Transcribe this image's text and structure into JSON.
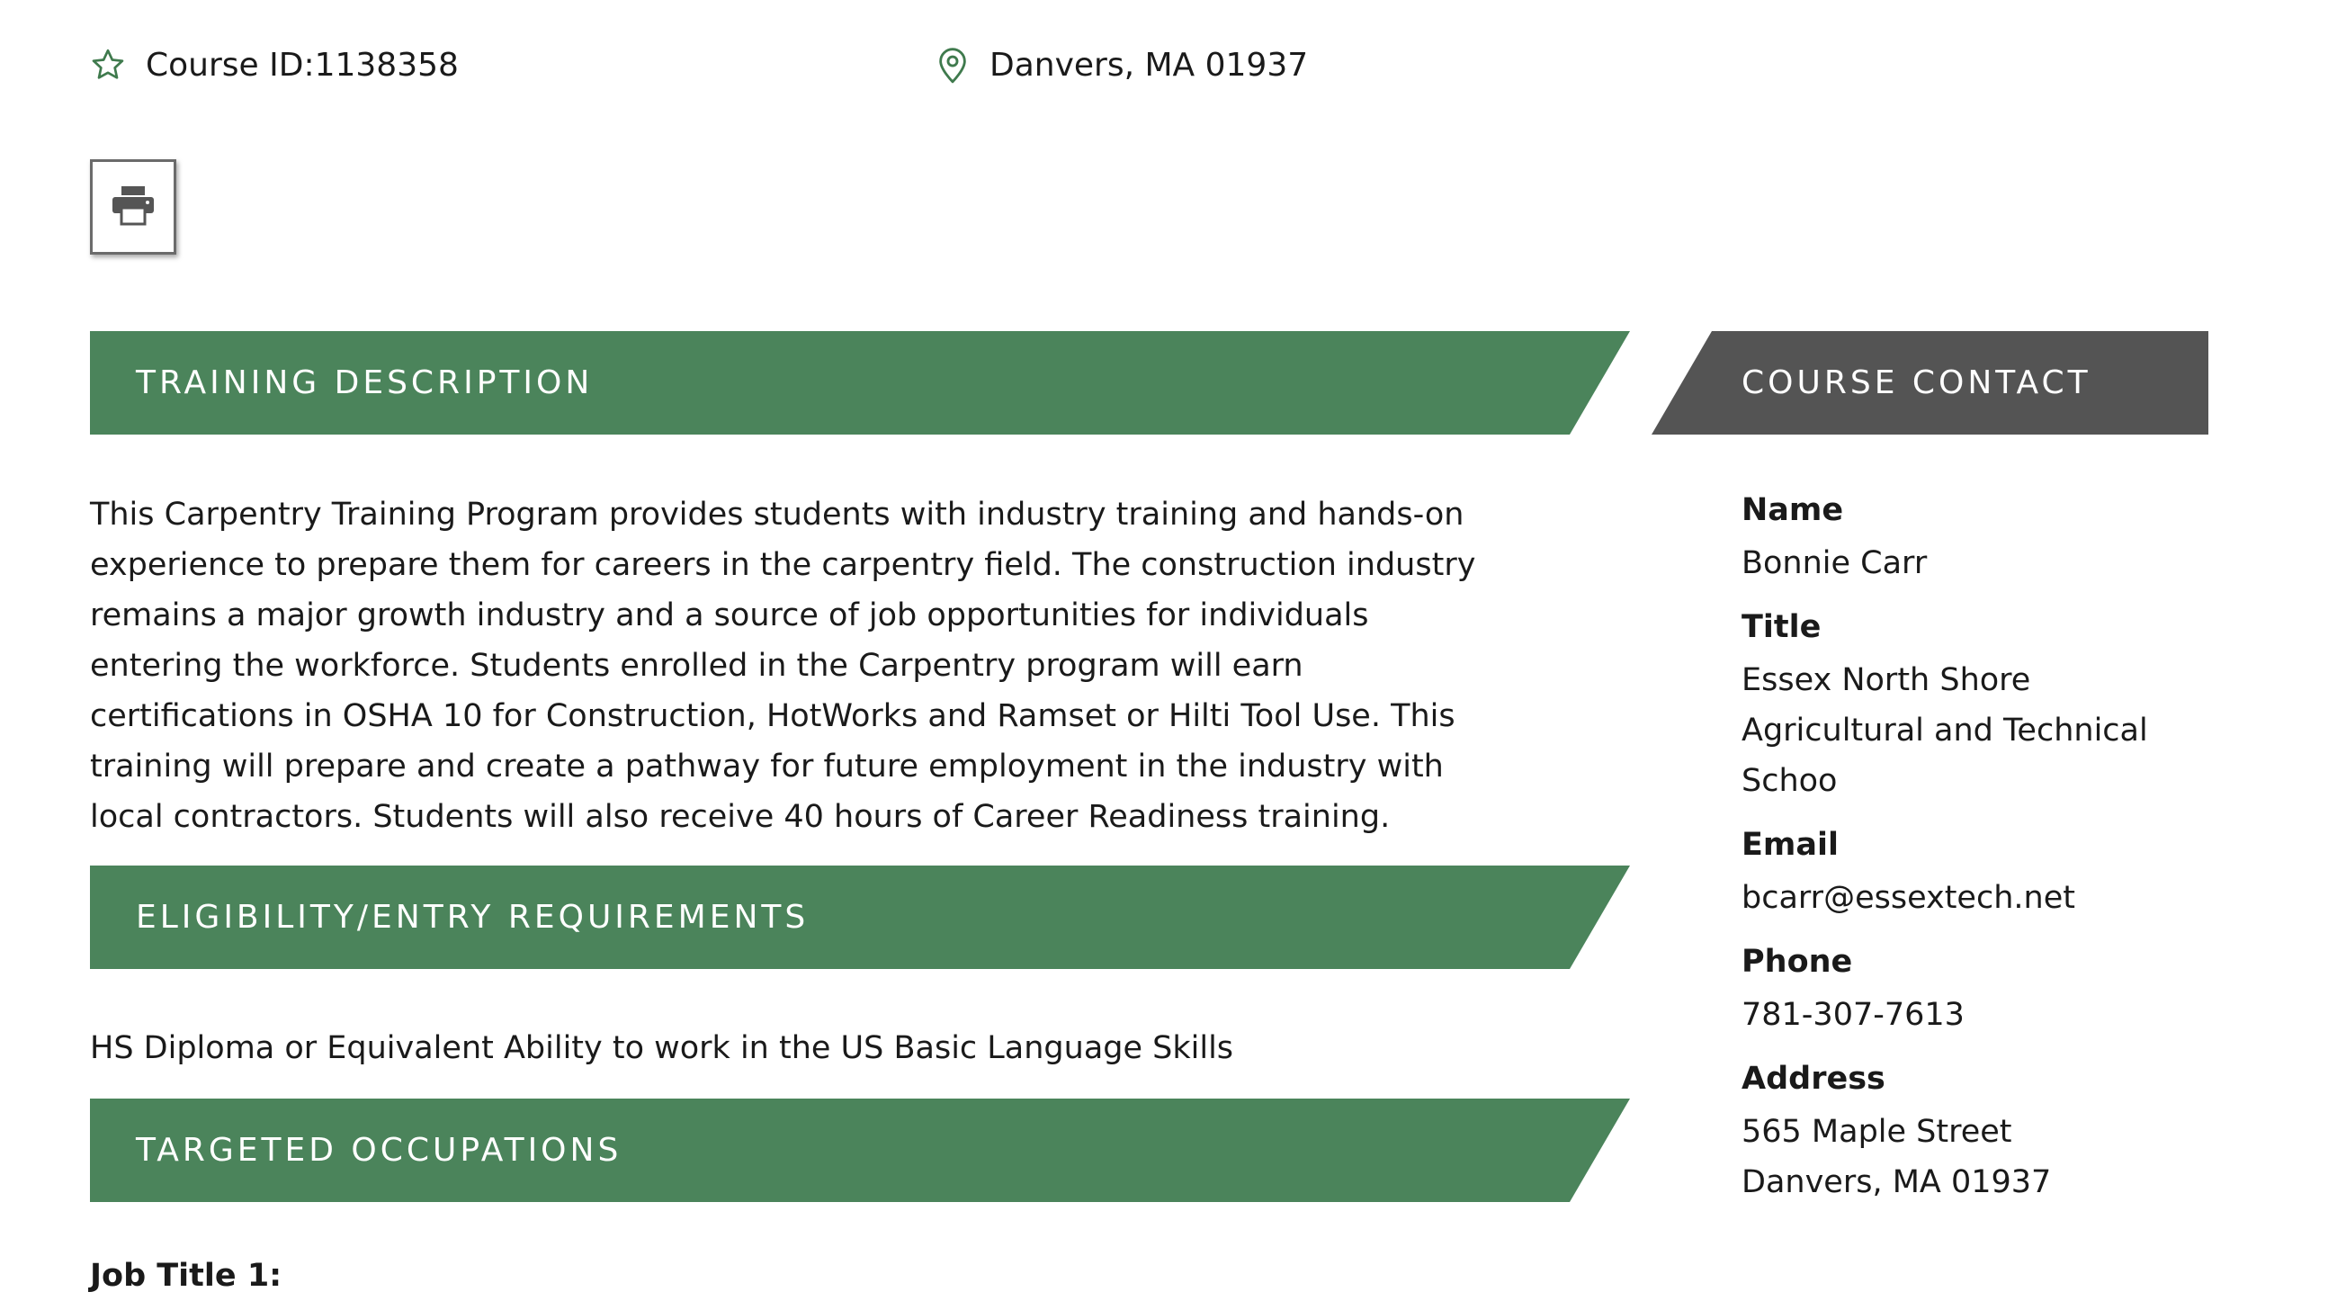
{
  "header": {
    "course_id": "Course ID:1138358",
    "location": "Danvers, MA 01937",
    "star_icon": "star-outline-icon",
    "pin_icon": "map-pin-icon"
  },
  "toolbar": {
    "print_icon": "printer-icon"
  },
  "sections": {
    "training_description": {
      "heading": "TRAINING DESCRIPTION",
      "body": "This Carpentry Training Program provides students with industry training and hands-on experience to prepare them for careers in the carpentry field.  The construction industry remains a major growth industry and a source of job opportunities for individuals entering the workforce.  Students enrolled in the Carpentry program will earn certifications in OSHA 10 for Construction, HotWorks and Ramset or Hilti Tool Use. This training will prepare and create a pathway for future employment in the industry with local contractors.  Students will also receive 40 hours of Career Readiness training."
    },
    "eligibility": {
      "heading": "ELIGIBILITY/ENTRY REQUIREMENTS",
      "body": "HS Diploma or Equivalent Ability to work in the US Basic Language Skills"
    },
    "targeted_occupations": {
      "heading": "TARGETED OCCUPATIONS",
      "job_title_1": "Job Title 1:"
    }
  },
  "contact": {
    "heading": "COURSE CONTACT",
    "name_label": "Name",
    "name": "Bonnie Carr",
    "title_label": "Title",
    "title": "Essex North Shore Agricultural and Technical Schoo",
    "email_label": "Email",
    "email": "bcarr@essextech.net",
    "phone_label": "Phone",
    "phone": "781-307-7613",
    "address_label": "Address",
    "address_line1": "565 Maple Street",
    "address_line2": "Danvers, MA 01937"
  },
  "colors": {
    "section_green": "#4b845b",
    "contact_gray": "#545454",
    "icon_green": "#3f7a4d"
  }
}
